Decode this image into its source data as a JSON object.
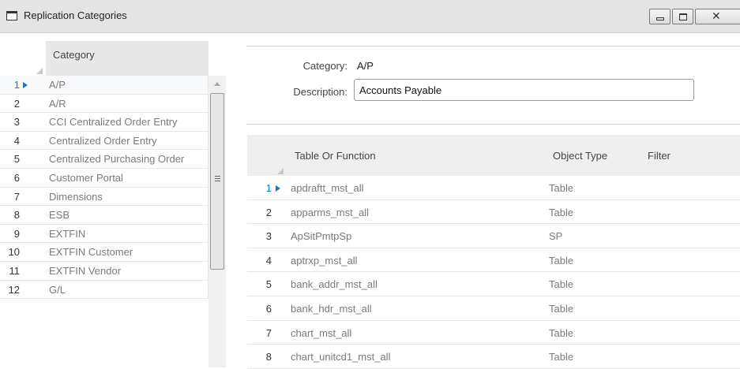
{
  "window": {
    "title": "Replication Categories",
    "minimize_label": "",
    "maximize_label": "",
    "close_label": "X"
  },
  "left_grid": {
    "header": "Category",
    "rows": [
      {
        "num": "1",
        "label": "A/P"
      },
      {
        "num": "2",
        "label": "A/R"
      },
      {
        "num": "3",
        "label": "CCI Centralized Order Entry"
      },
      {
        "num": "4",
        "label": "Centralized Order Entry"
      },
      {
        "num": "5",
        "label": "Centralized Purchasing Order"
      },
      {
        "num": "6",
        "label": "Customer Portal"
      },
      {
        "num": "7",
        "label": "Dimensions"
      },
      {
        "num": "8",
        "label": "ESB"
      },
      {
        "num": "9",
        "label": "EXTFIN"
      },
      {
        "num": "10",
        "label": "EXTFIN Customer"
      },
      {
        "num": "11",
        "label": "EXTFIN Vendor"
      },
      {
        "num": "12",
        "label": "G/L"
      }
    ],
    "selected_index": 0
  },
  "detail": {
    "category_label": "Category:",
    "category_value": "A/P",
    "description_label": "Description:",
    "description_value": "Accounts Payable"
  },
  "right_grid": {
    "headers": [
      "Table Or Function",
      "Object Type",
      "Filter"
    ],
    "rows": [
      {
        "num": "1",
        "name": "apdraftt_mst_all",
        "type": "Table",
        "filter": ""
      },
      {
        "num": "2",
        "name": "apparms_mst_all",
        "type": "Table",
        "filter": ""
      },
      {
        "num": "3",
        "name": "ApSitPmtpSp",
        "type": "SP",
        "filter": ""
      },
      {
        "num": "4",
        "name": "aptrxp_mst_all",
        "type": "Table",
        "filter": ""
      },
      {
        "num": "5",
        "name": "bank_addr_mst_all",
        "type": "Table",
        "filter": ""
      },
      {
        "num": "6",
        "name": "bank_hdr_mst_all",
        "type": "Table",
        "filter": ""
      },
      {
        "num": "7",
        "name": "chart_mst_all",
        "type": "Table",
        "filter": ""
      },
      {
        "num": "8",
        "name": "chart_unitcd1_mst_all",
        "type": "Table",
        "filter": ""
      }
    ],
    "selected_index": 0
  },
  "colors": {
    "accent": "#1e73c8",
    "titlebar": "#e4e4e4",
    "header_bg": "#e8e8e8",
    "cell_text": "#7a7a7a"
  }
}
